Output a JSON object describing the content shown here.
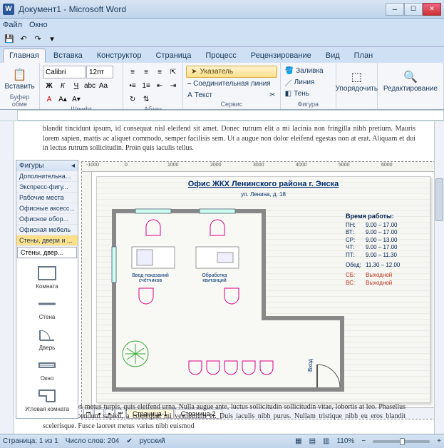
{
  "window": {
    "title": "Документ1 - Microsoft Word"
  },
  "menu": {
    "file": "Файл",
    "window": "Окно"
  },
  "tabs": {
    "home": "Главная",
    "insert": "Вставка",
    "constructor": "Конструктор",
    "layout": "Страница",
    "process": "Процесс",
    "review": "Рецензирование",
    "view": "Вид",
    "plan": "План"
  },
  "ribbon": {
    "paste": "Вставить",
    "clipboard_grp": "Буфер обме",
    "font_name": "Calibri",
    "font_size": "12пт",
    "font_grp": "Шрифт",
    "para_grp": "Абзац",
    "pointer": "Указатель",
    "conn_line": "Соединительная линия",
    "text_tool": "Текст",
    "service_grp": "Сервис",
    "fill": "Заливка",
    "line": "Линия",
    "shadow": "Тень",
    "figure_grp": "Фигура",
    "arrange": "Упорядочить",
    "editing": "Редактирование"
  },
  "body_top": "blandit tincidunt ipsum, id consequat nisl eleifend sit amet. Donec rutrum elit a mi lacinia non fringilla nibh pretium. Mauris lorem sapien, mattis ac aliquet commodo, semper facilisis sem. Ut a augue non dolor eleifend egestas non at erat. Aliquam et dui in lectus rutrum sollicitudin. Proin quis iaculis tellus.",
  "body_bot": "Curabitur non metus turpis, quis eleifend urna. Nulla augue ante, luctus sollicitudin sollicitudin vitae, lobortis at leo. Phasellus interdum bibendum sapien, a consequat mi vestibulum et. Duis iaculis nibh purus. Nullam tristique nibh eu eros blandit scelerisque. Fusce laoreet metus varius nibh euismod",
  "shapes": {
    "title": "Фигуры",
    "cats": [
      "Дополнительна...",
      "Экспресс-фигу...",
      "Рабочие места",
      "Офисные аксесс...",
      "Офисное обор...",
      "Офисная мебель",
      "Стены, двери и ..."
    ],
    "picker": "Стены, двер...",
    "items": {
      "room": "Комната",
      "wall": "Стена",
      "door": "Дверь",
      "window": "Окно",
      "corner": "Угловая комната"
    }
  },
  "plan": {
    "title": "Офис ЖКХ Ленинского района г. Энска",
    "address": "ул. Ленина, д. 18",
    "desk1": "Ввод показаний\nсчётчиков",
    "desk2": "Обработка\nквитанций",
    "entrance": "Вход",
    "hours_hdr": "Время работы:",
    "rows": [
      {
        "d": "ПН:",
        "t": "9.00 – 17.00"
      },
      {
        "d": "ВТ:",
        "t": "9.00 – 17.00"
      },
      {
        "d": "СР:",
        "t": "9.00 – 13.00"
      },
      {
        "d": "ЧТ:",
        "t": "9.00 – 17.00"
      },
      {
        "d": "ПТ:",
        "t": "9.00 – 11.30"
      }
    ],
    "lunch": {
      "d": "Обед:",
      "t": "11.30 – 12.00"
    },
    "weekend": [
      {
        "d": "СБ:",
        "t": "Выходной"
      },
      {
        "d": "ВС:",
        "t": "Выходной"
      }
    ]
  },
  "page_tabs": {
    "p1": "Страница-1",
    "p2": "Страница-2"
  },
  "status": {
    "page": "Страница: 1 из 1",
    "words": "Число слов: 204",
    "lang": "русский",
    "zoom": "110%"
  },
  "ruler_marks": [
    "-1000",
    "0",
    "1000",
    "2000",
    "3000",
    "4000",
    "5000",
    "6000"
  ]
}
